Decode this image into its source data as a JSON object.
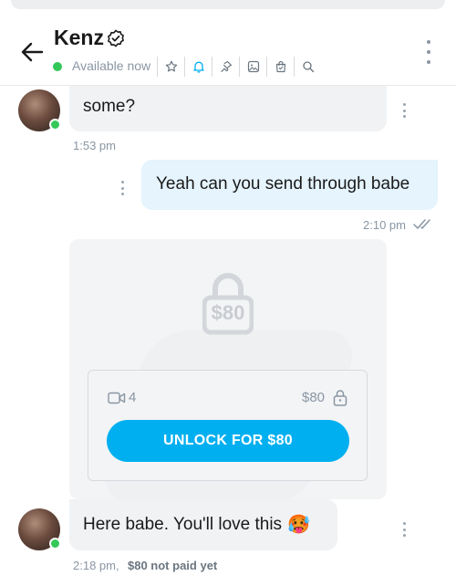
{
  "header": {
    "name": "Kenz",
    "status": "Available now"
  },
  "header_icons": [
    "star-icon",
    "bell-icon",
    "pin-icon",
    "image-icon",
    "bag-icon",
    "search-icon"
  ],
  "messages": {
    "m1": {
      "text": "some?",
      "time": "1:53 pm"
    },
    "m2": {
      "text": "Yeah can you send through babe",
      "time": "2:10 pm"
    },
    "ppv": {
      "price_display": "$80",
      "video_count": "4",
      "price": "$80",
      "button": "UNLOCK FOR $80"
    },
    "m3": {
      "text": "Here babe. You'll love this",
      "emoji": "🥵",
      "time": "2:18 pm,",
      "paid_status": "$80 not paid yet"
    }
  },
  "colors": {
    "accent": "#00aff0",
    "online": "#34c759",
    "incoming_bubble": "#f0f2f4",
    "outgoing_bubble": "#e5f4fd",
    "muted_text": "#8a96a3"
  }
}
